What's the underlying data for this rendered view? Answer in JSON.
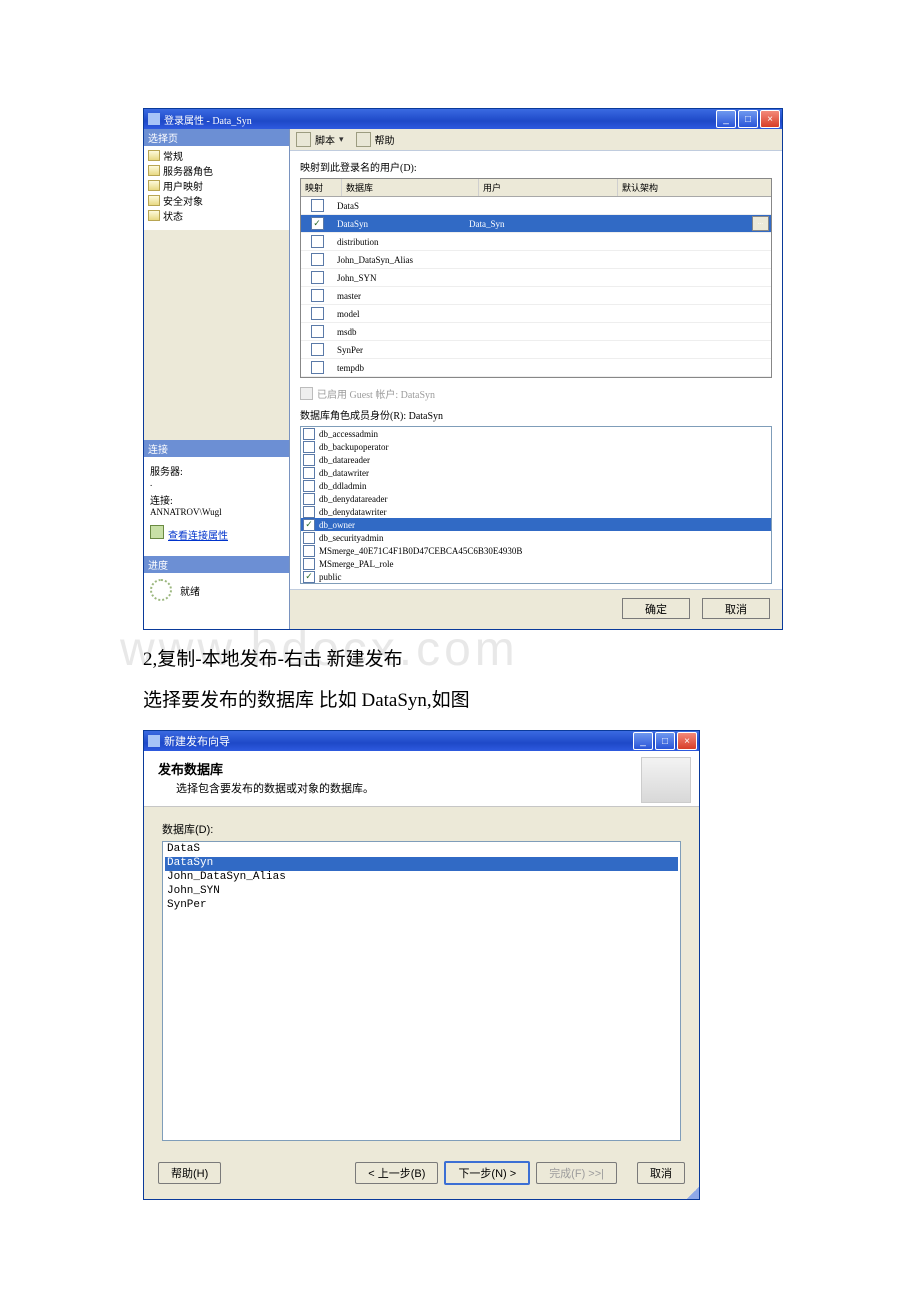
{
  "win1": {
    "title": "登录属性 - Data_Syn",
    "left": {
      "hdr_select": "选择页",
      "pages": [
        "常规",
        "服务器角色",
        "用户映射",
        "安全对象",
        "状态"
      ],
      "hdr_conn": "连接",
      "server_lbl": "服务器:",
      "server_val": ".",
      "conn_lbl": "连接:",
      "conn_val": "ANNATROV\\Wugl",
      "view_conn": "查看连接属性",
      "hdr_progress": "进度",
      "progress_val": "就绪"
    },
    "tb": {
      "script": "脚本",
      "help": "帮助"
    },
    "rp": {
      "map_caption": "映射到此登录名的用户(D):",
      "cols": {
        "map": "映射",
        "db": "数据库",
        "user": "用户",
        "schema": "默认架构"
      },
      "rows": [
        {
          "db": "DataS"
        },
        {
          "db": "DataSyn",
          "user": "Data_Syn",
          "sel": true,
          "checked": true,
          "ellipsis": true
        },
        {
          "db": "distribution"
        },
        {
          "db": "John_DataSyn_Alias"
        },
        {
          "db": "John_SYN"
        },
        {
          "db": "master"
        },
        {
          "db": "model"
        },
        {
          "db": "msdb"
        },
        {
          "db": "SynPer"
        },
        {
          "db": "tempdb"
        }
      ],
      "guest_chk": "已启用 Guest 帐户: DataSyn",
      "roles_caption": "数据库角色成员身份(R): DataSyn",
      "roles": [
        {
          "n": "db_accessadmin"
        },
        {
          "n": "db_backupoperator"
        },
        {
          "n": "db_datareader"
        },
        {
          "n": "db_datawriter"
        },
        {
          "n": "db_ddladmin"
        },
        {
          "n": "db_denydatareader"
        },
        {
          "n": "db_denydatawriter"
        },
        {
          "n": "db_owner",
          "checked": true,
          "sel": true
        },
        {
          "n": "db_securityadmin"
        },
        {
          "n": "MSmerge_40E71C4F1B0D47CEBCA45C6B30E4930B"
        },
        {
          "n": "MSmerge_PAL_role"
        },
        {
          "n": "public",
          "checked": true
        }
      ]
    },
    "buttons": {
      "ok": "确定",
      "cancel": "取消"
    }
  },
  "bodytext": {
    "line1": "2,复制-本地发布-右击 新建发布",
    "line2": "选择要发布的数据库 比如 DataSyn,如图"
  },
  "win2": {
    "title": "新建发布向导",
    "head_title": "发布数据库",
    "head_sub": "选择包含要发布的数据或对象的数据库。",
    "list_label": "数据库(D):",
    "items": [
      {
        "n": "DataS"
      },
      {
        "n": "DataSyn",
        "sel": true
      },
      {
        "n": "John_DataSyn_Alias"
      },
      {
        "n": "John_SYN"
      },
      {
        "n": "SynPer"
      }
    ],
    "buttons": {
      "help": "帮助(H)",
      "back": "< 上一步(B)",
      "next": "下一步(N) >",
      "finish": "完成(F) >>|",
      "cancel": "取消"
    }
  },
  "watermark": "www.bdocx.com"
}
